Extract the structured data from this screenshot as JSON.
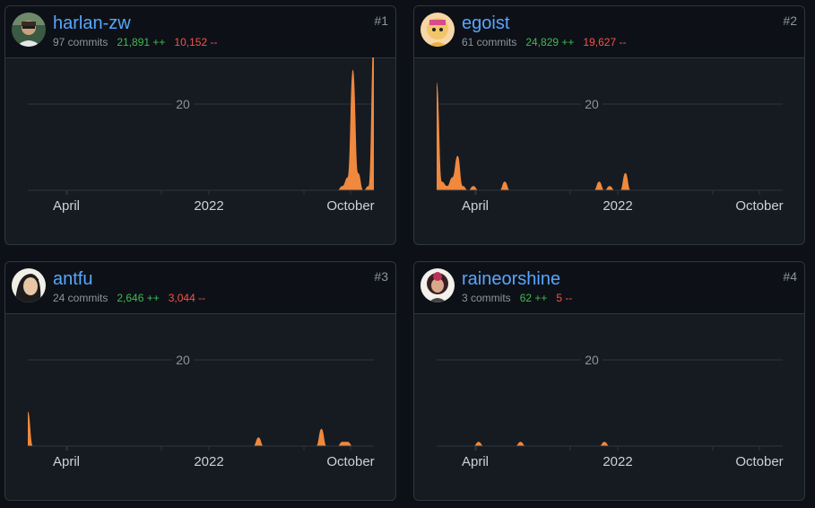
{
  "contributors": [
    {
      "rank": "#1",
      "username": "harlan-zw",
      "commits": "97 commits",
      "additions": "21,891 ++",
      "deletions": "10,152 --",
      "avatar": "avatar-icon"
    },
    {
      "rank": "#2",
      "username": "egoist",
      "commits": "61 commits",
      "additions": "24,829 ++",
      "deletions": "19,627 --",
      "avatar": "avatar-icon"
    },
    {
      "rank": "#3",
      "username": "antfu",
      "commits": "24 commits",
      "additions": "2,646 ++",
      "deletions": "3,044 --",
      "avatar": "avatar-icon"
    },
    {
      "rank": "#4",
      "username": "raineorshine",
      "commits": "3 commits",
      "additions": "62 ++",
      "deletions": "5 --",
      "avatar": "avatar-icon"
    }
  ],
  "colors": {
    "area": "#f0883e",
    "grid": "#30363d",
    "link": "#58a6ff",
    "additions": "#3fb950",
    "deletions": "#f85149"
  },
  "chart_data": [
    {
      "type": "area",
      "series": [
        {
          "values": [
            0,
            0,
            0,
            0,
            0,
            0,
            0,
            0,
            0,
            0,
            0,
            0,
            0,
            0,
            0,
            0,
            0,
            0,
            0,
            0,
            0,
            0,
            0,
            0,
            0,
            0,
            0,
            0,
            0,
            0,
            0,
            0,
            0,
            0,
            0,
            0,
            0,
            0,
            0,
            0,
            0,
            0,
            0,
            0,
            0,
            0,
            0,
            0,
            0,
            0,
            0,
            0,
            0,
            0,
            0,
            0,
            0,
            0,
            0,
            0,
            1,
            3,
            28,
            4,
            0,
            1,
            36
          ]
        }
      ],
      "x_tick_labels": [
        "April",
        "2022",
        "October"
      ],
      "y_tick_labels": [
        "20"
      ],
      "ylim": [
        0,
        30
      ],
      "grid": true
    },
    {
      "type": "area",
      "series": [
        {
          "values": [
            25,
            2,
            1,
            3,
            8,
            1,
            0,
            1,
            0,
            0,
            0,
            0,
            0,
            2,
            0,
            0,
            0,
            0,
            0,
            0,
            0,
            0,
            0,
            0,
            0,
            0,
            0,
            0,
            0,
            0,
            0,
            2,
            0,
            1,
            0,
            0,
            4,
            0,
            0,
            0,
            0,
            0,
            0,
            0,
            0,
            0,
            0,
            0,
            0,
            0,
            0,
            0,
            0,
            0,
            0,
            0,
            0,
            0,
            0,
            0,
            0,
            0,
            0,
            0,
            0,
            0,
            0
          ]
        }
      ],
      "x_tick_labels": [
        "April",
        "2022",
        "October"
      ],
      "y_tick_labels": [
        "20"
      ],
      "ylim": [
        0,
        30
      ],
      "grid": true
    },
    {
      "type": "area",
      "series": [
        {
          "values": [
            8,
            0,
            0,
            0,
            0,
            0,
            0,
            0,
            0,
            0,
            0,
            0,
            0,
            0,
            0,
            0,
            0,
            0,
            0,
            0,
            0,
            0,
            0,
            0,
            0,
            0,
            0,
            0,
            0,
            0,
            0,
            0,
            0,
            0,
            0,
            0,
            0,
            0,
            0,
            0,
            0,
            0,
            0,
            0,
            2,
            0,
            0,
            0,
            0,
            0,
            0,
            0,
            0,
            0,
            0,
            0,
            4,
            0,
            0,
            0,
            1,
            1,
            0,
            0,
            0,
            0,
            0
          ]
        }
      ],
      "x_tick_labels": [
        "April",
        "2022",
        "October"
      ],
      "y_tick_labels": [
        "20"
      ],
      "ylim": [
        0,
        30
      ],
      "grid": true
    },
    {
      "type": "area",
      "series": [
        {
          "values": [
            0,
            0,
            0,
            0,
            0,
            0,
            0,
            0,
            1,
            0,
            0,
            0,
            0,
            0,
            0,
            0,
            1,
            0,
            0,
            0,
            0,
            0,
            0,
            0,
            0,
            0,
            0,
            0,
            0,
            0,
            0,
            0,
            1,
            0,
            0,
            0,
            0,
            0,
            0,
            0,
            0,
            0,
            0,
            0,
            0,
            0,
            0,
            0,
            0,
            0,
            0,
            0,
            0,
            0,
            0,
            0,
            0,
            0,
            0,
            0,
            0,
            0,
            0,
            0,
            0,
            0,
            0
          ]
        }
      ],
      "x_tick_labels": [
        "April",
        "2022",
        "October"
      ],
      "y_tick_labels": [
        "20"
      ],
      "ylim": [
        0,
        30
      ],
      "grid": true
    }
  ]
}
